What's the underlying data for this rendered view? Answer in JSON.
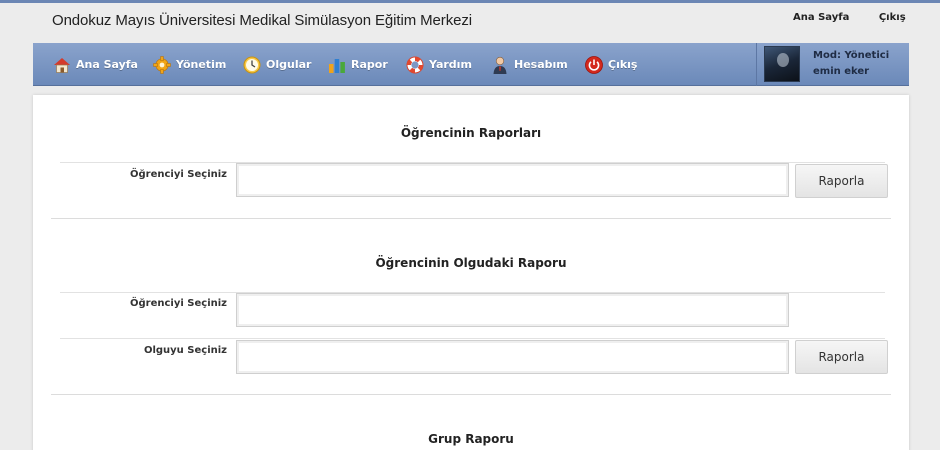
{
  "header": {
    "title": "Ondokuz Mayıs Üniversitesi Medikal Simülasyon Eğitim Merkezi",
    "links": {
      "home": "Ana Sayfa",
      "logout": "Çıkış"
    }
  },
  "nav": {
    "items": [
      {
        "label": "Ana Sayfa",
        "icon": "home-icon"
      },
      {
        "label": "Yönetim",
        "icon": "gear-icon"
      },
      {
        "label": "Olgular",
        "icon": "clock-icon"
      },
      {
        "label": "Rapor",
        "icon": "bar-chart-icon"
      },
      {
        "label": "Yardım",
        "icon": "lifebuoy-icon"
      },
      {
        "label": "Hesabım",
        "icon": "user-icon"
      },
      {
        "label": "Çıkış",
        "icon": "power-icon"
      }
    ],
    "user": {
      "role": "Mod: Yönetici",
      "name": "emin eker"
    }
  },
  "sections": {
    "student_reports": {
      "title": "Öğrencinin Raporları",
      "student_label": "Öğrenciyi Seçiniz",
      "student_value": "",
      "button": "Raporla"
    },
    "student_case_report": {
      "title": "Öğrencinin Olgudaki Raporu",
      "student_label": "Öğrenciyi Seçiniz",
      "student_value": "",
      "case_label": "Olguyu Seçiniz",
      "case_value": "",
      "button": "Raporla"
    },
    "group_report": {
      "title": "Grup Raporu"
    }
  },
  "colors": {
    "nav_top": "#8aa3cc",
    "nav_bottom": "#6b89b9",
    "top_line": "#6b86b4",
    "background": "#ececec"
  }
}
